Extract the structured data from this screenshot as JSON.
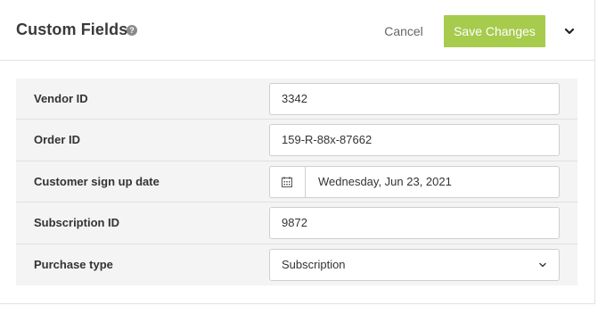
{
  "header": {
    "title": "Custom Fields",
    "help_icon": "question-circle-icon",
    "help_glyph": "?",
    "cancel_label": "Cancel",
    "save_label": "Save Changes",
    "more_icon": "chevron-down-icon"
  },
  "fields": [
    {
      "label": "Vendor ID",
      "value": "3342",
      "kind": "text"
    },
    {
      "label": "Order ID",
      "value": "159-R-88x-87662",
      "kind": "text"
    },
    {
      "label": "Customer sign up date",
      "value": "Wednesday, Jun 23, 2021",
      "kind": "date",
      "icon": "calendar-icon"
    },
    {
      "label": "Subscription ID",
      "value": "9872",
      "kind": "text"
    },
    {
      "label": "Purchase type",
      "value": "Subscription",
      "kind": "select",
      "icon": "chevron-down-icon"
    }
  ],
  "colors": {
    "accent": "#a6cb4d",
    "row_background": "#f4f4f4",
    "border": "#cfcfcf"
  }
}
